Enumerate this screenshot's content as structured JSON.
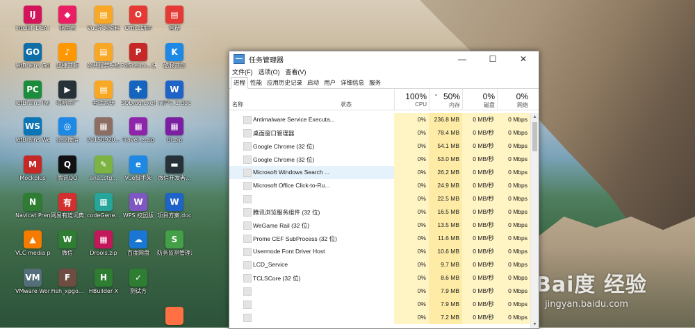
{
  "desktop_icons": [
    {
      "label": "IntelliJ IDEA 2019.2.2",
      "color": "#d4145a",
      "glyph": "IJ",
      "name": "intellij-icon"
    },
    {
      "label": "JetBrains GoLan...",
      "color": "#0d6ea8",
      "glyph": "GO",
      "name": "goland-icon"
    },
    {
      "label": "JetBrains PyCha...",
      "color": "#1a8c3c",
      "glyph": "PC",
      "name": "pycharm-icon"
    },
    {
      "label": "JetBrains WebSto...",
      "color": "#0b75b5",
      "glyph": "WS",
      "name": "webstorm-icon"
    },
    {
      "label": "Mockplus",
      "color": "#c62828",
      "glyph": "M",
      "name": "mockplus-icon"
    },
    {
      "label": "Navicat Premium 12",
      "color": "#2e7d32",
      "glyph": "N",
      "name": "navicat-icon"
    },
    {
      "label": "VLC media player",
      "color": "#f57c00",
      "glyph": "▲",
      "name": "vlc-icon"
    },
    {
      "label": "VMware Workstati...",
      "color": "#546e7a",
      "glyph": "VM",
      "name": "vmware-icon"
    },
    {
      "label": "花生壳",
      "color": "#e91e63",
      "glyph": "◆",
      "name": "peanut-icon"
    },
    {
      "label": "迅捷音频",
      "color": "#ff9800",
      "glyph": "♪",
      "name": "audio-tool-icon"
    },
    {
      "label": "嘻哈手厂",
      "color": "#263238",
      "glyph": "▶",
      "name": "video-tool-icon"
    },
    {
      "label": "企业微信",
      "color": "#1e88e5",
      "glyph": "◎",
      "name": "wecom-icon"
    },
    {
      "label": "腾讯QQ",
      "color": "#111111",
      "glyph": "Q",
      "name": "qq-icon"
    },
    {
      "label": "网易有道词典",
      "color": "#d32f2f",
      "glyph": "有",
      "name": "youdao-icon"
    },
    {
      "label": "微信",
      "color": "#2e7d32",
      "glyph": "W",
      "name": "wechat-icon"
    },
    {
      "label": "Fish_xpgo...",
      "color": "#6d4c41",
      "glyph": "F",
      "name": "fish-file-icon"
    },
    {
      "label": "Vue学习资料",
      "color": "#f9a825",
      "glyph": "▤",
      "name": "vue-folder-icon"
    },
    {
      "label": "公共服务系统",
      "color": "#f9a825",
      "glyph": "▤",
      "name": "public-service-folder-icon"
    },
    {
      "label": "考试系统",
      "color": "#f9a825",
      "glyph": "▤",
      "name": "exam-folder-icon"
    },
    {
      "label": "20150920...",
      "color": "#8d6e63",
      "glyph": "▦",
      "name": "archive-file-icon"
    },
    {
      "label": "ana..stg...",
      "color": "#7cb342",
      "glyph": "✎",
      "name": "notepad-file-icon"
    },
    {
      "label": "codeGene...",
      "color": "#26a69a",
      "glyph": "▦",
      "name": "codegen-icon"
    },
    {
      "label": "Drools.zip",
      "color": "#c2185b",
      "glyph": "▦",
      "name": "drools-zip-icon"
    },
    {
      "label": "HBuilder X",
      "color": "#2e7d32",
      "glyph": "H",
      "name": "hbuilder-icon"
    },
    {
      "label": "Office助手",
      "color": "#e53935",
      "glyph": "O",
      "name": "office-helper-icon"
    },
    {
      "label": "PdShell.x...快捷方式",
      "color": "#c62828",
      "glyph": "P",
      "name": "pdshell-icon"
    },
    {
      "label": "SQLyog.exe快捷方式",
      "color": "#1565c0",
      "glyph": "✚",
      "name": "sqlyog-icon"
    },
    {
      "label": "Travel_z.zip",
      "color": "#8e24aa",
      "glyph": "▦",
      "name": "travel-zip-icon"
    },
    {
      "label": "Vue脚手架",
      "color": "#1e88e5",
      "glyph": "e",
      "name": "vue-cli-icon"
    },
    {
      "label": "WPS 校园版",
      "color": "#7e57c2",
      "glyph": "W",
      "name": "wps-icon"
    },
    {
      "label": "百度网盘",
      "color": "#1976d2",
      "glyph": "☁",
      "name": "baidu-netdisk-icon"
    },
    {
      "label": "测试方",
      "color": "#2e7d32",
      "glyph": "✓",
      "name": "test-icon"
    },
    {
      "label": "答辩",
      "color": "#e53935",
      "glyph": "▤",
      "name": "defense-doc-icon"
    },
    {
      "label": "酷我音乐",
      "color": "#1e88e5",
      "glyph": "K",
      "name": "kuwo-icon"
    },
    {
      "label": "门户v_1.doc",
      "color": "#1e63c7",
      "glyph": "W",
      "name": "portal-doc-icon"
    },
    {
      "label": "UI.zip",
      "color": "#7b1fa2",
      "glyph": "▦",
      "name": "ui-zip-icon"
    },
    {
      "label": "微信开发者...",
      "color": "#263238",
      "glyph": "▬",
      "name": "wx-devtools-icon"
    },
    {
      "label": "项目方案.doc",
      "color": "#1e63c7",
      "glyph": "W",
      "name": "project-doc-icon"
    },
    {
      "label": "防务监测管理系统...",
      "color": "#43a047",
      "glyph": "S",
      "name": "monitor-system-icon"
    },
    {
      "label": "",
      "color": "#ff7043",
      "glyph": "",
      "name": "app-icon"
    }
  ],
  "watermark": {
    "big": "Bai度 经验",
    "small": "jingyan.baidu.com"
  },
  "task_manager": {
    "title": "任务管理器",
    "menu": [
      "文件(F)",
      "选项(O)",
      "查看(V)"
    ],
    "tabs": [
      "进程",
      "性能",
      "应用历史记录",
      "启动",
      "用户",
      "详细信息",
      "服务"
    ],
    "active_tab": 0,
    "columns": {
      "name": "名称",
      "status": "状态",
      "cpu": {
        "pct": "100%",
        "label": "CPU"
      },
      "mem": {
        "pct": "50%",
        "label": "内存"
      },
      "disk": {
        "pct": "0%",
        "label": "磁盘"
      },
      "net": {
        "pct": "0%",
        "label": "网络"
      }
    },
    "selected_row": 4,
    "rows": [
      {
        "name": "Antimalware Service Executa...",
        "cpu": "0%",
        "mem": "236.8 MB",
        "disk": "0 MB/秒",
        "net": "0 Mbps"
      },
      {
        "name": "桌面窗口管理器",
        "cpu": "0%",
        "mem": "78.4 MB",
        "disk": "0 MB/秒",
        "net": "0 Mbps"
      },
      {
        "name": "Google Chrome (32 位)",
        "cpu": "0%",
        "mem": "54.1 MB",
        "disk": "0 MB/秒",
        "net": "0 Mbps"
      },
      {
        "name": "Google Chrome (32 位)",
        "cpu": "0%",
        "mem": "53.0 MB",
        "disk": "0 MB/秒",
        "net": "0 Mbps"
      },
      {
        "name": "Microsoft Windows Search ...",
        "cpu": "0%",
        "mem": "26.2 MB",
        "disk": "0 MB/秒",
        "net": "0 Mbps"
      },
      {
        "name": "Microsoft Office Click-to-Ru...",
        "cpu": "0%",
        "mem": "24.9 MB",
        "disk": "0 MB/秒",
        "net": "0 Mbps"
      },
      {
        "name": "",
        "cpu": "0%",
        "mem": "22.5 MB",
        "disk": "0 MB/秒",
        "net": "0 Mbps"
      },
      {
        "name": "腾讯浏览服务组件 (32 位)",
        "cpu": "0%",
        "mem": "16.5 MB",
        "disk": "0 MB/秒",
        "net": "0 Mbps"
      },
      {
        "name": "WeGame Rail (32 位)",
        "cpu": "0%",
        "mem": "13.5 MB",
        "disk": "0 MB/秒",
        "net": "0 Mbps"
      },
      {
        "name": "Prome CEF SubProcess (32 位)",
        "cpu": "0%",
        "mem": "11.6 MB",
        "disk": "0 MB/秒",
        "net": "0 Mbps"
      },
      {
        "name": "Usermode Font Driver Host",
        "cpu": "0%",
        "mem": "10.6 MB",
        "disk": "0 MB/秒",
        "net": "0 Mbps"
      },
      {
        "name": "LCD_Service",
        "cpu": "0%",
        "mem": "9.7 MB",
        "disk": "0 MB/秒",
        "net": "0 Mbps"
      },
      {
        "name": "TCLSCore (32 位)",
        "cpu": "0%",
        "mem": "8.6 MB",
        "disk": "0 MB/秒",
        "net": "0 Mbps"
      },
      {
        "name": "",
        "cpu": "0%",
        "mem": "7.9 MB",
        "disk": "0 MB/秒",
        "net": "0 Mbps"
      },
      {
        "name": "",
        "cpu": "0%",
        "mem": "7.9 MB",
        "disk": "0 MB/秒",
        "net": "0 Mbps"
      },
      {
        "name": "",
        "cpu": "0%",
        "mem": "7.2 MB",
        "disk": "0 MB/秒",
        "net": "0 Mbps"
      }
    ]
  }
}
